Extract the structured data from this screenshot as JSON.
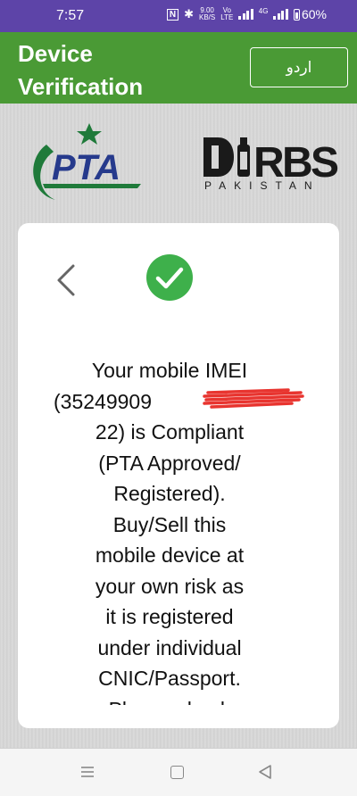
{
  "status_bar": {
    "time": "7:57",
    "nfc": "N",
    "bluetooth": "✱",
    "net_speed_top": "9.00",
    "net_speed_bottom": "KB/S",
    "volte_top": "Vo",
    "volte_bottom": "LTE",
    "network": "4G",
    "battery": "60%"
  },
  "header": {
    "title": "Device Verification",
    "language_button": "اردو"
  },
  "logos": {
    "pta": "PTA",
    "dirbs_main": "RBS",
    "dirbs_sub": "PAKISTAN"
  },
  "card": {
    "message_lines": [
      "Your mobile IMEI",
      "(35249909",
      "22) is Compliant",
      "(PTA Approved/",
      "Registered).",
      "Buy/Sell this",
      "mobile device at",
      "your own risk as",
      "it is registered",
      "under individual",
      "CNIC/Passport.",
      "Please check"
    ]
  },
  "colors": {
    "status_bar": "#5d44a8",
    "header": "#4a9a35",
    "check": "#3eb04b",
    "pta_green": "#1f7a3a",
    "pta_blue": "#263a8c"
  }
}
